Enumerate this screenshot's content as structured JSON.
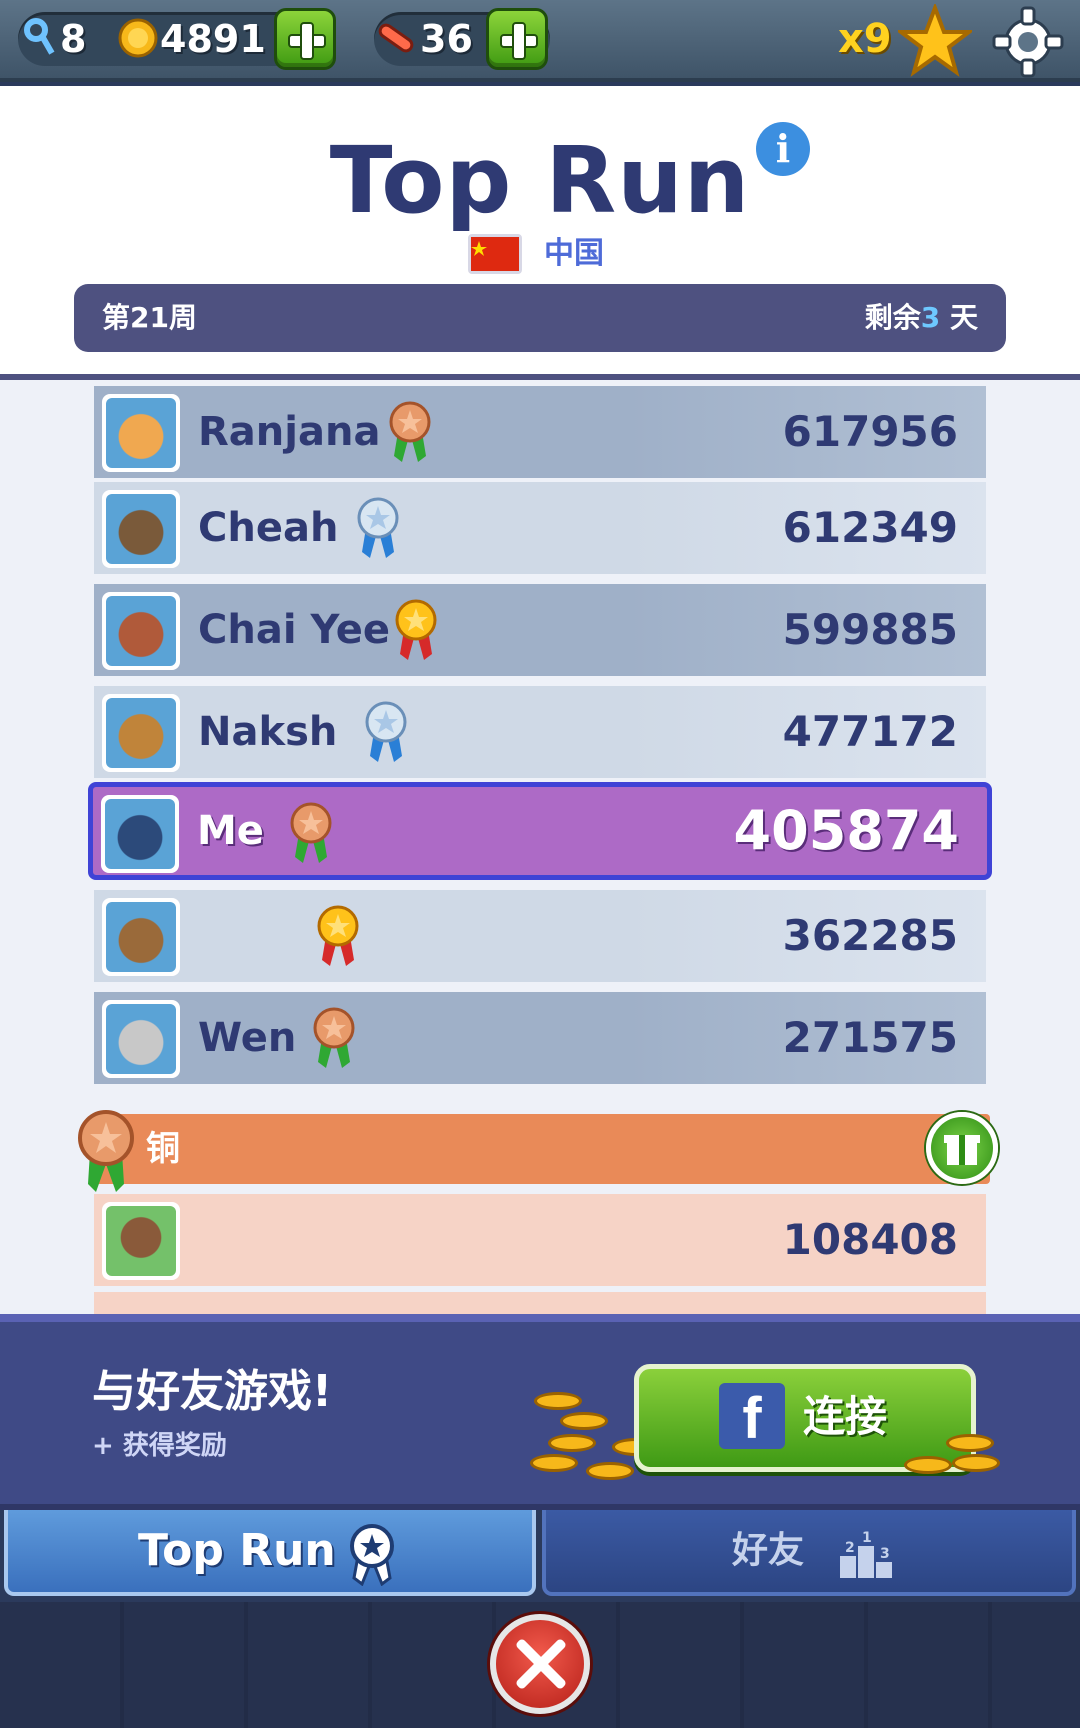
{
  "topbar": {
    "keys": "8",
    "coins": "4891",
    "boards": "36",
    "multiplier": "x9"
  },
  "header": {
    "title": "Top Run",
    "country": "中国",
    "week_label": "第21周",
    "remaining_prefix": "剩余",
    "remaining_days": "3",
    "remaining_suffix": " 天"
  },
  "leaderboard": [
    {
      "name": "Ranjana",
      "score": "617956",
      "medal": "bronze",
      "avatar_color": "#f0a850"
    },
    {
      "name": "Cheah",
      "score": "612349",
      "medal": "silver",
      "avatar_color": "#7a5a3a"
    },
    {
      "name": "Chai Yee",
      "score": "599885",
      "medal": "gold",
      "avatar_color": "#b05a3a"
    },
    {
      "name": "Naksh",
      "score": "477172",
      "medal": "silver",
      "avatar_color": "#c0843a"
    },
    {
      "name": "Me",
      "score": "405874",
      "medal": "bronze",
      "avatar_color": "#2c4a7a"
    },
    {
      "name": "",
      "score": "362285",
      "medal": "gold",
      "avatar_color": "#9a6a3a"
    },
    {
      "name": "Wen",
      "score": "271575",
      "medal": "bronze",
      "avatar_color": "#c8c8c8"
    }
  ],
  "tier": {
    "label": "铜",
    "entry_score": "108408"
  },
  "banner": {
    "title": "与好友游戏!",
    "subtitle": "+ 获得奖励",
    "connect_label": "连接"
  },
  "tabs": {
    "top_run": "Top Run",
    "friends": "好友"
  },
  "colors": {
    "accent": "#2f3a73",
    "me_row": "#ad6ac6",
    "bronze_tier": "#e98a58",
    "green_button": "#3f9a12"
  }
}
